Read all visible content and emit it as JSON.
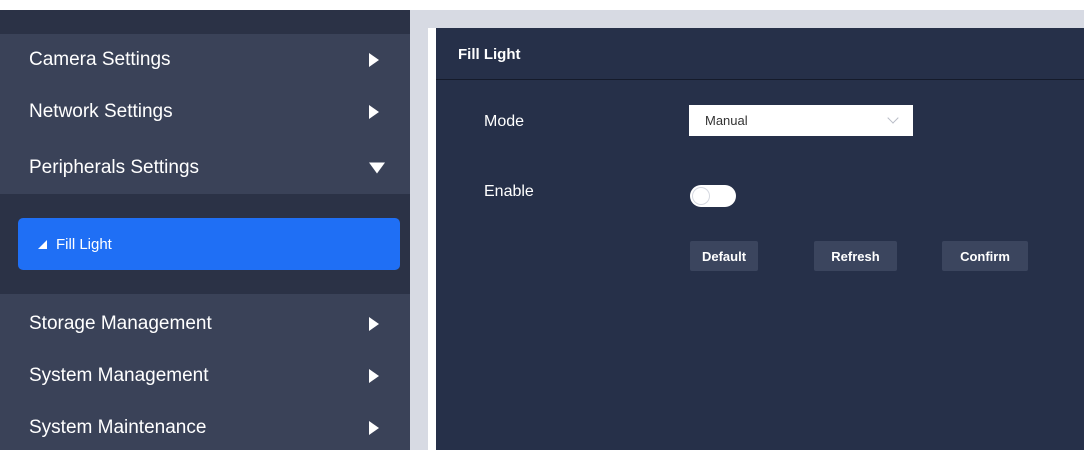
{
  "sidebar": {
    "items": [
      {
        "label": "Camera Settings",
        "arrow": "right-triangle-icon"
      },
      {
        "label": "Network Settings",
        "arrow": "right-triangle-icon"
      },
      {
        "label": "Peripherals Settings",
        "arrow": "down-triangle-icon"
      },
      {
        "label": "Storage Management",
        "arrow": "right-triangle-icon"
      },
      {
        "label": "System Management",
        "arrow": "right-triangle-icon"
      },
      {
        "label": "System Maintenance",
        "arrow": "right-triangle-icon"
      }
    ],
    "submenu": {
      "label": "Fill Light",
      "active": true
    }
  },
  "content": {
    "title": "Fill Light",
    "mode": {
      "label": "Mode",
      "value": "Manual"
    },
    "enable": {
      "label": "Enable",
      "checked": false
    },
    "buttons": {
      "default": "Default",
      "refresh": "Refresh",
      "confirm": "Confirm"
    }
  },
  "colors": {
    "sidebar_bg": "#3a4258",
    "sidebar_dark": "#2b3246",
    "accent": "#1f6ff5",
    "content_bg": "#263049",
    "button_bg": "#3b455e",
    "gap": "#d7dae3"
  }
}
